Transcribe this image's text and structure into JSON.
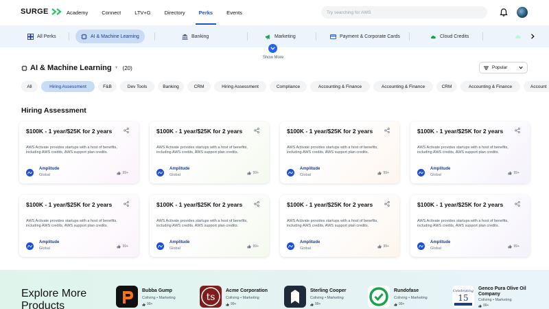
{
  "brand": {
    "name": "SURGE"
  },
  "nav": {
    "links": [
      "Academy",
      "Connect",
      "LTV+G",
      "Directory",
      "Perks",
      "Events"
    ],
    "active": "Perks",
    "search_placeholder": "Try searching for AWS"
  },
  "categories": {
    "items": [
      {
        "label": "All Perks",
        "icon": "grid-icon"
      },
      {
        "label": "AI & Machine Learning",
        "icon": "chip-icon",
        "active": true
      },
      {
        "label": "Banking",
        "icon": "bank-icon"
      },
      {
        "label": "Marketing",
        "icon": "megaphone-icon"
      },
      {
        "label": "Payment & Corporate Cards",
        "icon": "card-icon"
      },
      {
        "label": "Cloud Credits",
        "icon": "cloud-icon"
      }
    ],
    "show_more": "Show More"
  },
  "page": {
    "title": "AI & Machine Learning",
    "count": "(20)",
    "sort": "Popular"
  },
  "chips": [
    "All",
    "Hiring Assessment",
    "F&B",
    "Dev Tools",
    "Banking",
    "CRM",
    "Hiring Assessment",
    "Compliance",
    "Accounting & Finance",
    "Accounting & Finance",
    "CRM",
    "Accounting & Finance",
    "Account"
  ],
  "active_chip": "Hiring Assessment",
  "section": {
    "title": "Hiring Assessment",
    "cards": [
      {
        "title": "$100K - 1 year/$25K for 2 years",
        "desc": "AWS Activate provides startups with a host of benefits, including AWS credits, AWS support plan credits.",
        "brand": "Amplitude",
        "region": "Global",
        "likes": "99+"
      },
      {
        "title": "$100K - 1 year/$25K for 2 years",
        "desc": "AWS Activate provides startups with a host of benefits, including AWS credits, AWS support plan credits.",
        "brand": "Amplitude",
        "region": "Global",
        "likes": "99+"
      },
      {
        "title": "$100K - 1 year/$25K for 2 years",
        "desc": "AWS Activate provides startups with a host of benefits, including AWS credits, AWS support plan credits.",
        "brand": "Amplitude",
        "region": "Global",
        "likes": "99+"
      },
      {
        "title": "$100K - 1 year/$25K for 2 years",
        "desc": "AWS Activate provides startups with a host of benefits, including AWS credits, AWS support plan credits.",
        "brand": "Amplitude",
        "region": "Global",
        "likes": "99+"
      },
      {
        "title": "$100K - 1 year/$25K for 2 years",
        "desc": "AWS Activate provides startups with a host of benefits, including AWS credits, AWS support plan credits.",
        "brand": "Amplitude",
        "region": "Global",
        "likes": "99+"
      },
      {
        "title": "$100K - 1 year/$25K for 2 years",
        "desc": "AWS Activate provides startups with a host of benefits, including AWS credits, AWS support plan credits.",
        "brand": "Amplitude",
        "region": "Global",
        "likes": "99+"
      },
      {
        "title": "$100K - 1 year/$25K for 2 years",
        "desc": "AWS Activate provides startups with a host of benefits, including AWS credits, AWS support plan credits.",
        "brand": "Amplitude",
        "region": "Global",
        "likes": "99+"
      },
      {
        "title": "$100K - 1 year/$25K for 2 years",
        "desc": "AWS Activate provides startups with a host of benefits, including AWS credits, AWS support plan credits.",
        "brand": "Amplitude",
        "region": "Global",
        "likes": "99+"
      }
    ]
  },
  "explore": {
    "title": "Explore More Products",
    "products": [
      {
        "name": "Bubba Gump",
        "category": "Coliving • Marketing",
        "likes": "99+"
      },
      {
        "name": "Acme Corporation",
        "category": "Coliving • Marketing",
        "likes": "99+"
      },
      {
        "name": "Sterling Cooper",
        "category": "Coliving • Marketing",
        "likes": "99+"
      },
      {
        "name": "Rundofase",
        "category": "Coliving • Marketing",
        "likes": "99+"
      },
      {
        "name": "Genco Pura Olive Oil Company",
        "category": "Coliving • Marketing",
        "likes": "99+"
      }
    ]
  },
  "colors": {
    "primary": "#1d4ed8",
    "accent": "#2563eb",
    "chip_active": "#c8dcf6",
    "logo_arrow": "#22c55e"
  }
}
